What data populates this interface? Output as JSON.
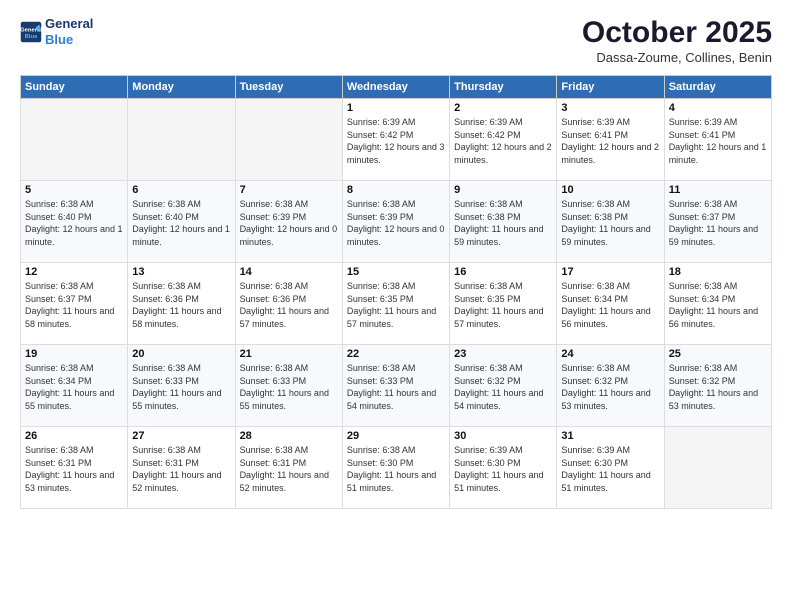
{
  "header": {
    "logo_line1": "General",
    "logo_line2": "Blue",
    "month": "October 2025",
    "location": "Dassa-Zoume, Collines, Benin"
  },
  "days_of_week": [
    "Sunday",
    "Monday",
    "Tuesday",
    "Wednesday",
    "Thursday",
    "Friday",
    "Saturday"
  ],
  "weeks": [
    [
      {
        "day": "",
        "text": ""
      },
      {
        "day": "",
        "text": ""
      },
      {
        "day": "",
        "text": ""
      },
      {
        "day": "1",
        "text": "Sunrise: 6:39 AM\nSunset: 6:42 PM\nDaylight: 12 hours and 3 minutes."
      },
      {
        "day": "2",
        "text": "Sunrise: 6:39 AM\nSunset: 6:42 PM\nDaylight: 12 hours and 2 minutes."
      },
      {
        "day": "3",
        "text": "Sunrise: 6:39 AM\nSunset: 6:41 PM\nDaylight: 12 hours and 2 minutes."
      },
      {
        "day": "4",
        "text": "Sunrise: 6:39 AM\nSunset: 6:41 PM\nDaylight: 12 hours and 1 minute."
      }
    ],
    [
      {
        "day": "5",
        "text": "Sunrise: 6:38 AM\nSunset: 6:40 PM\nDaylight: 12 hours and 1 minute."
      },
      {
        "day": "6",
        "text": "Sunrise: 6:38 AM\nSunset: 6:40 PM\nDaylight: 12 hours and 1 minute."
      },
      {
        "day": "7",
        "text": "Sunrise: 6:38 AM\nSunset: 6:39 PM\nDaylight: 12 hours and 0 minutes."
      },
      {
        "day": "8",
        "text": "Sunrise: 6:38 AM\nSunset: 6:39 PM\nDaylight: 12 hours and 0 minutes."
      },
      {
        "day": "9",
        "text": "Sunrise: 6:38 AM\nSunset: 6:38 PM\nDaylight: 11 hours and 59 minutes."
      },
      {
        "day": "10",
        "text": "Sunrise: 6:38 AM\nSunset: 6:38 PM\nDaylight: 11 hours and 59 minutes."
      },
      {
        "day": "11",
        "text": "Sunrise: 6:38 AM\nSunset: 6:37 PM\nDaylight: 11 hours and 59 minutes."
      }
    ],
    [
      {
        "day": "12",
        "text": "Sunrise: 6:38 AM\nSunset: 6:37 PM\nDaylight: 11 hours and 58 minutes."
      },
      {
        "day": "13",
        "text": "Sunrise: 6:38 AM\nSunset: 6:36 PM\nDaylight: 11 hours and 58 minutes."
      },
      {
        "day": "14",
        "text": "Sunrise: 6:38 AM\nSunset: 6:36 PM\nDaylight: 11 hours and 57 minutes."
      },
      {
        "day": "15",
        "text": "Sunrise: 6:38 AM\nSunset: 6:35 PM\nDaylight: 11 hours and 57 minutes."
      },
      {
        "day": "16",
        "text": "Sunrise: 6:38 AM\nSunset: 6:35 PM\nDaylight: 11 hours and 57 minutes."
      },
      {
        "day": "17",
        "text": "Sunrise: 6:38 AM\nSunset: 6:34 PM\nDaylight: 11 hours and 56 minutes."
      },
      {
        "day": "18",
        "text": "Sunrise: 6:38 AM\nSunset: 6:34 PM\nDaylight: 11 hours and 56 minutes."
      }
    ],
    [
      {
        "day": "19",
        "text": "Sunrise: 6:38 AM\nSunset: 6:34 PM\nDaylight: 11 hours and 55 minutes."
      },
      {
        "day": "20",
        "text": "Sunrise: 6:38 AM\nSunset: 6:33 PM\nDaylight: 11 hours and 55 minutes."
      },
      {
        "day": "21",
        "text": "Sunrise: 6:38 AM\nSunset: 6:33 PM\nDaylight: 11 hours and 55 minutes."
      },
      {
        "day": "22",
        "text": "Sunrise: 6:38 AM\nSunset: 6:33 PM\nDaylight: 11 hours and 54 minutes."
      },
      {
        "day": "23",
        "text": "Sunrise: 6:38 AM\nSunset: 6:32 PM\nDaylight: 11 hours and 54 minutes."
      },
      {
        "day": "24",
        "text": "Sunrise: 6:38 AM\nSunset: 6:32 PM\nDaylight: 11 hours and 53 minutes."
      },
      {
        "day": "25",
        "text": "Sunrise: 6:38 AM\nSunset: 6:32 PM\nDaylight: 11 hours and 53 minutes."
      }
    ],
    [
      {
        "day": "26",
        "text": "Sunrise: 6:38 AM\nSunset: 6:31 PM\nDaylight: 11 hours and 53 minutes."
      },
      {
        "day": "27",
        "text": "Sunrise: 6:38 AM\nSunset: 6:31 PM\nDaylight: 11 hours and 52 minutes."
      },
      {
        "day": "28",
        "text": "Sunrise: 6:38 AM\nSunset: 6:31 PM\nDaylight: 11 hours and 52 minutes."
      },
      {
        "day": "29",
        "text": "Sunrise: 6:38 AM\nSunset: 6:30 PM\nDaylight: 11 hours and 51 minutes."
      },
      {
        "day": "30",
        "text": "Sunrise: 6:39 AM\nSunset: 6:30 PM\nDaylight: 11 hours and 51 minutes."
      },
      {
        "day": "31",
        "text": "Sunrise: 6:39 AM\nSunset: 6:30 PM\nDaylight: 11 hours and 51 minutes."
      },
      {
        "day": "",
        "text": ""
      }
    ]
  ]
}
